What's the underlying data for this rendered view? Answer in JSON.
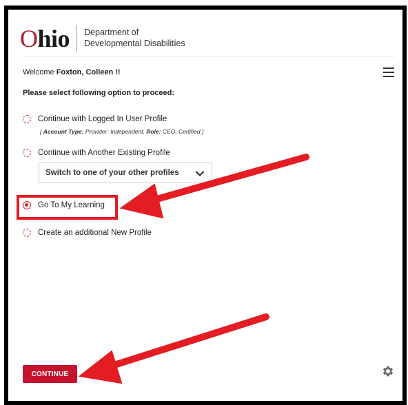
{
  "header": {
    "logo_ohio_prefix": "O",
    "logo_ohio_rest": "hio",
    "dept_line1": "Department of",
    "dept_line2": "Developmental Disabilities"
  },
  "welcome": {
    "prefix": "Welcome ",
    "user": "Foxton, Colleen !!"
  },
  "instruction": "Please select following option to proceed:",
  "options": [
    {
      "label": "Continue with Logged In User Profile",
      "selected": false
    },
    {
      "label": "Continue with Another Existing Profile",
      "selected": false
    },
    {
      "label": "Go To My Learning",
      "selected": true
    },
    {
      "label": "Create an additional New Profile",
      "selected": false
    }
  ],
  "account_info": {
    "open": "[ ",
    "type_label": "Account Type:",
    "type_value": " Provider: Independent, ",
    "role_label": "Role:",
    "role_value": " CEO, Certified ]"
  },
  "profile_select": {
    "value": "Switch to one of your other profiles"
  },
  "continue_label": "CONTINUE",
  "colors": {
    "brand_red": "#c4122f",
    "highlight_red": "#e31d23",
    "arrow_red": "#e31d23"
  },
  "icons": [
    "menu-icon",
    "chevron-down-icon",
    "gear-icon"
  ]
}
